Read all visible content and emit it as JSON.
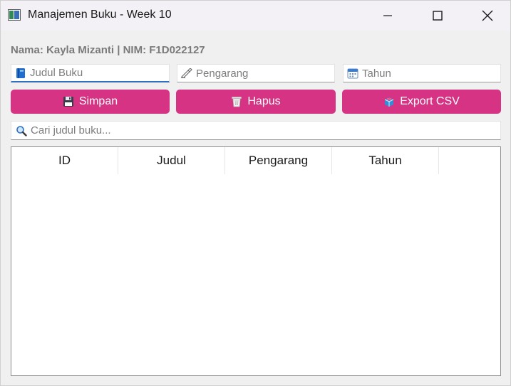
{
  "window": {
    "title": "Manajemen Buku - Week 10",
    "controls": [
      "minimize-icon",
      "maximize-icon",
      "close-icon"
    ]
  },
  "header": {
    "info": "Nama: Kayla Mizanti | NIM: F1D022127"
  },
  "form": {
    "judul_placeholder": "Judul Buku",
    "pengarang_placeholder": "Pengarang",
    "tahun_placeholder": "Tahun",
    "icons": [
      "book-icon",
      "writing-hand-icon",
      "calendar-icon"
    ]
  },
  "buttons": {
    "simpan": "Simpan",
    "hapus": "Hapus",
    "export": "Export CSV",
    "icons": [
      "floppy-disk-icon",
      "trash-icon",
      "package-icon"
    ],
    "color": "#d63384"
  },
  "search": {
    "placeholder": "Cari judul buku...",
    "icon": "magnifier-icon"
  },
  "table": {
    "columns": [
      "ID",
      "Judul",
      "Pengarang",
      "Tahun"
    ],
    "rows": []
  }
}
